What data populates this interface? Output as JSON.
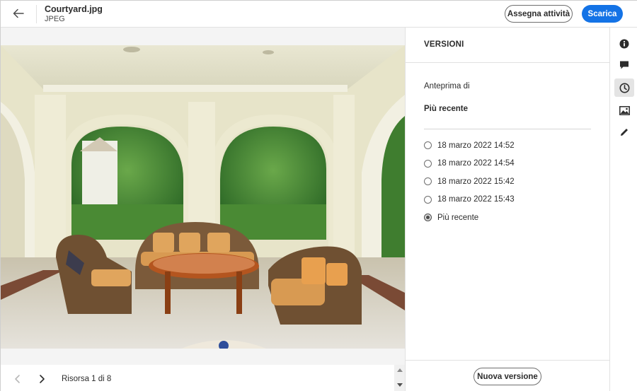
{
  "header": {
    "file_name": "Courtyard.jpg",
    "file_type": "JPEG",
    "assign_label": "Assegna attività",
    "download_label": "Scarica"
  },
  "viewer": {
    "asset_counter": "Risorsa 1 di 8"
  },
  "panel": {
    "title": "VERSIONI",
    "preview_label": "Anteprima di",
    "preview_value": "Più recente",
    "versions": [
      {
        "label": "18 marzo 2022 14:52",
        "selected": false
      },
      {
        "label": "18 marzo 2022 14:54",
        "selected": false
      },
      {
        "label": "18 marzo 2022 15:42",
        "selected": false
      },
      {
        "label": "18 marzo 2022 15:43",
        "selected": false
      },
      {
        "label": "Più recente",
        "selected": true
      }
    ],
    "new_version_label": "Nuova versione"
  },
  "rail": {
    "items": [
      {
        "icon": "info-icon",
        "active": false
      },
      {
        "icon": "comment-icon",
        "active": false
      },
      {
        "icon": "clock-icon",
        "active": true
      },
      {
        "icon": "image-icon",
        "active": false
      },
      {
        "icon": "pencil-icon",
        "active": false
      }
    ]
  },
  "colors": {
    "accent": "#1473e6",
    "active_rail_bg": "#e4e4e4"
  }
}
